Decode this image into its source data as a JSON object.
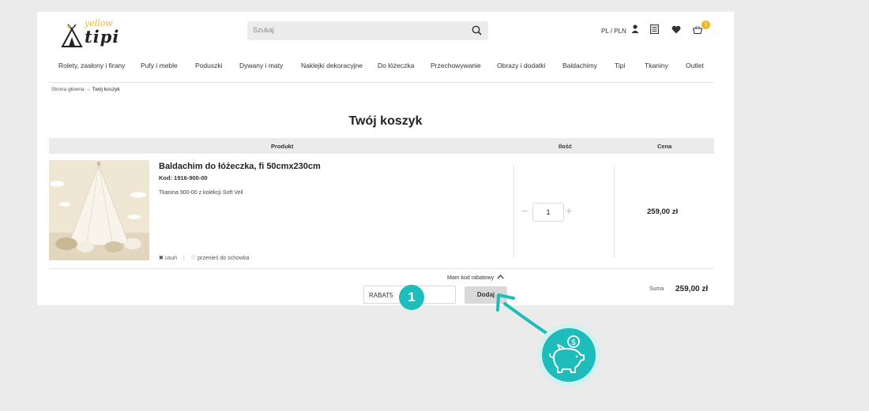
{
  "header": {
    "logo_top": "yellow",
    "logo_main": "tipi",
    "search_placeholder": "Szukaj",
    "lang": "PL / PLN",
    "cart_count": "1"
  },
  "nav": [
    "Rolety, zasłony i firany",
    "Pufy i meble",
    "Poduszki",
    "Dywany i maty",
    "Naklejki dekoracyjne",
    "Do łóżeczka",
    "Przechowywanie",
    "Obrazy i dodatki",
    "Baldachimy",
    "Tipi",
    "Tkaniny",
    "Outlet"
  ],
  "breadcrumb": {
    "home": "Strona główna",
    "sep": "→",
    "current": "Twój koszyk"
  },
  "page_title": "Twój koszyk",
  "table": {
    "col_product": "Produkt",
    "col_qty": "Ilość",
    "col_price": "Cena"
  },
  "item": {
    "name": "Baldachim do łóżeczka, fi 50cmx230cm",
    "code": "Kod: 1916-900-00",
    "desc": "Tkanina 900-00 z kolekcji Soft Veil",
    "remove": "usuń",
    "save": "przenieś do schowka",
    "qty": "1",
    "price": "259,00 zł"
  },
  "promo": {
    "toggle": "Mam kod rabatowy",
    "code_value": "RABAT5",
    "button": "Dodaj"
  },
  "summary": {
    "label": "Suma",
    "value": "259,00 zł"
  },
  "annotation": {
    "step": "1",
    "accent": "#1fbcbc"
  },
  "colors": {
    "brand_yellow": "#f0b722",
    "accent_teal": "#1fbcbc"
  }
}
